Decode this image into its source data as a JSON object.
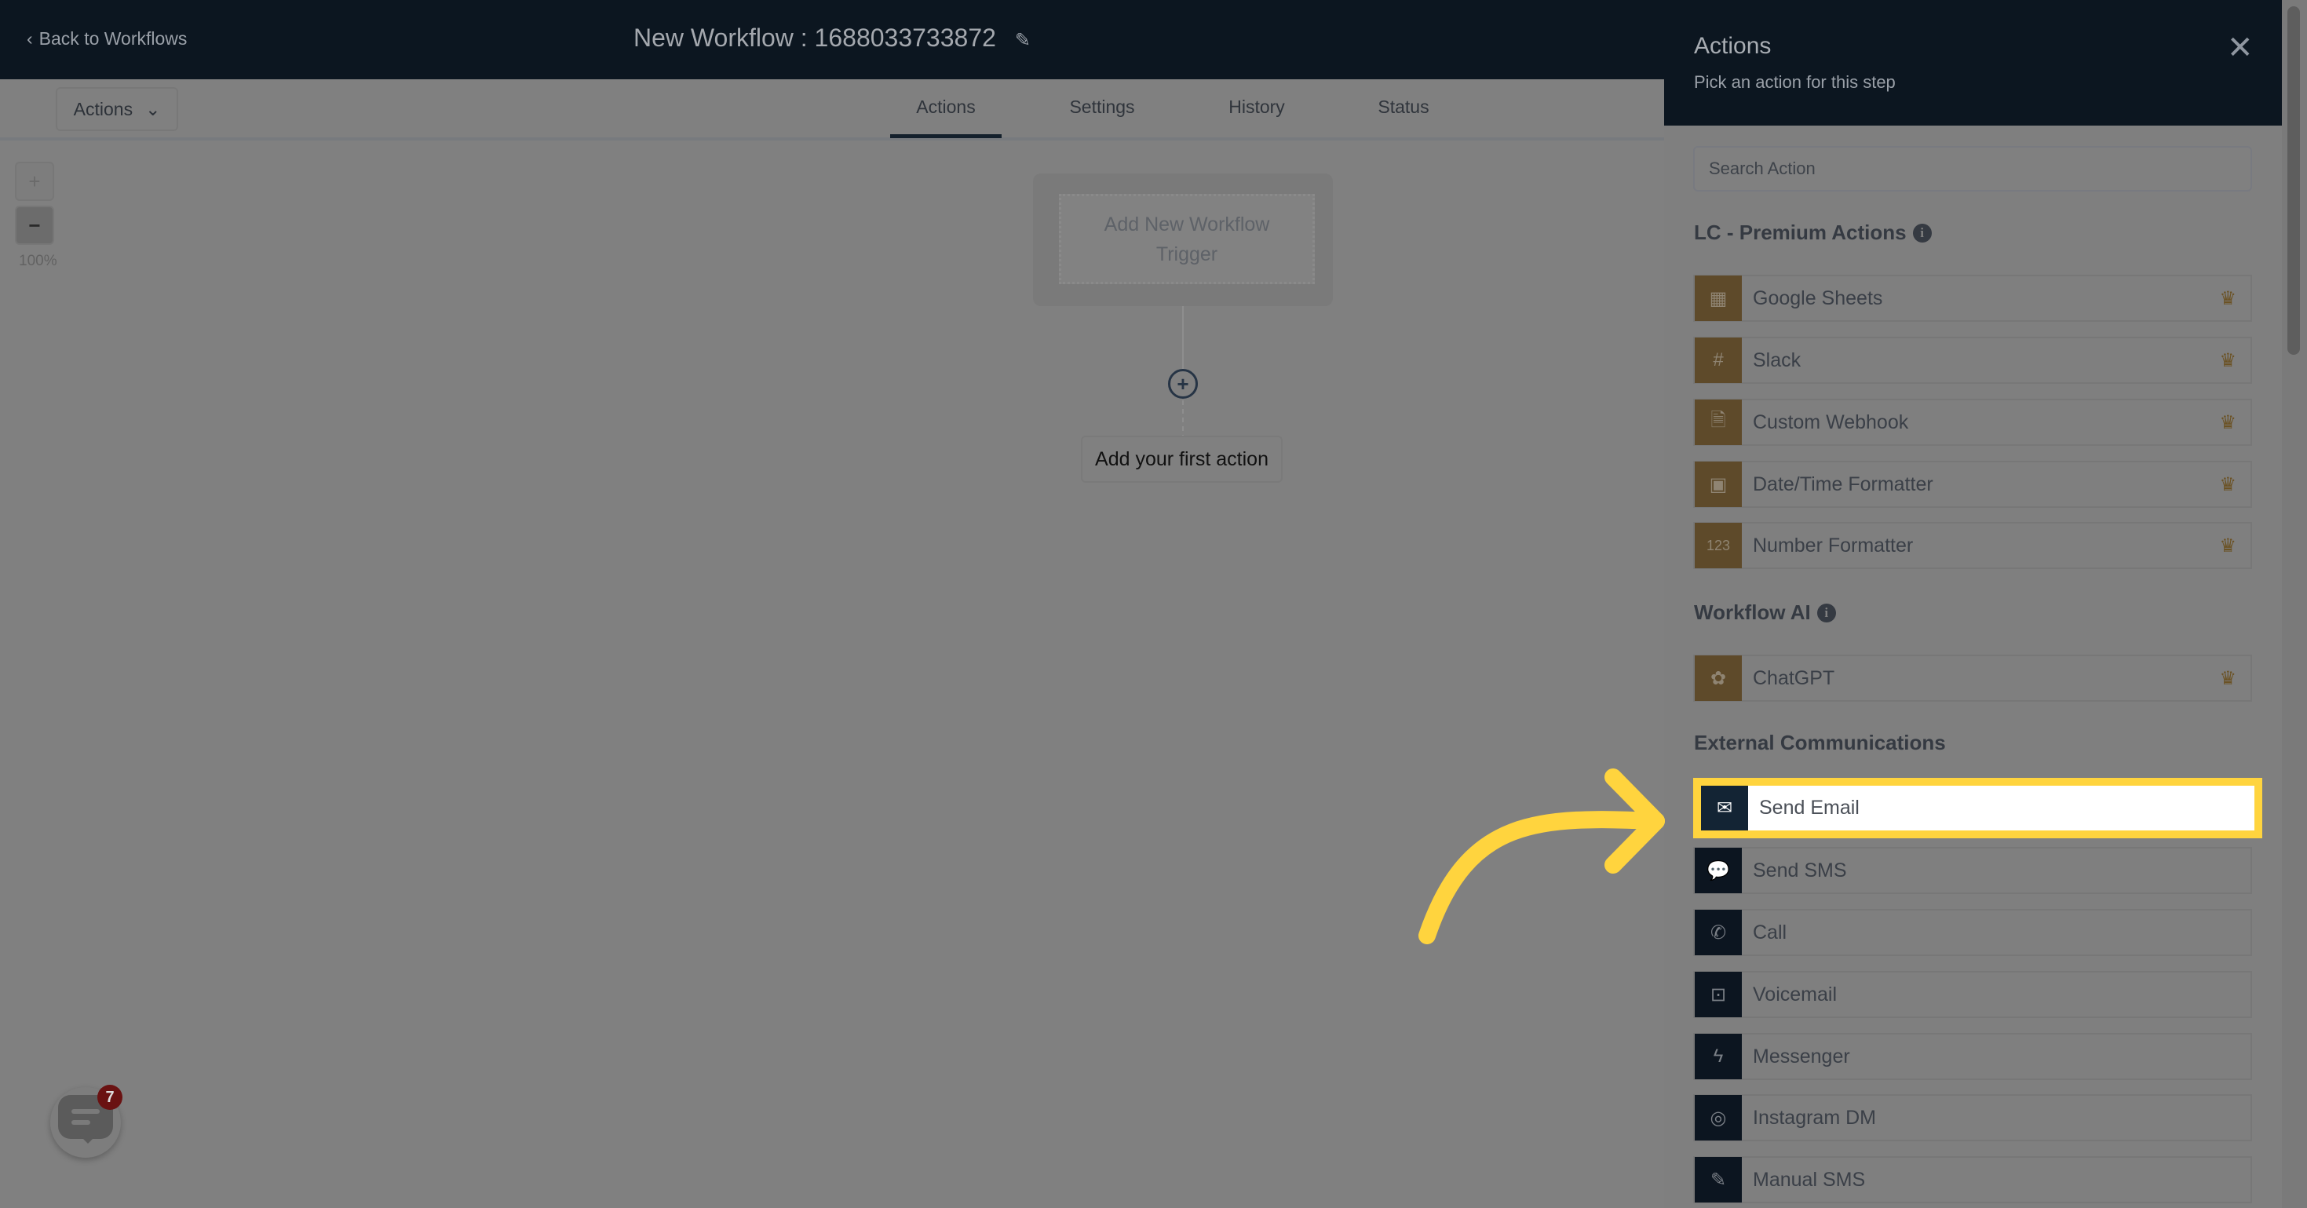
{
  "header": {
    "back_label": "Back to Workflows",
    "title": "New Workflow : 1688033733872"
  },
  "toolbar": {
    "actions_dropdown": "Actions",
    "tabs": [
      {
        "label": "Actions",
        "active": true
      },
      {
        "label": "Settings"
      },
      {
        "label": "History"
      },
      {
        "label": "Status"
      }
    ]
  },
  "canvas": {
    "zoom_in": "+",
    "zoom_out": "−",
    "zoom_level": "100%",
    "trigger_label": "Add New Workflow Trigger",
    "first_action_label": "Add your first action"
  },
  "chat_widget": {
    "badge_count": "7"
  },
  "panel": {
    "title": "Actions",
    "subtitle": "Pick an action for this step",
    "search_placeholder": "Search Action",
    "sections": [
      {
        "heading": "LC - Premium Actions",
        "items": [
          {
            "label": "Google Sheets",
            "icon": "spreadsheet-icon"
          },
          {
            "label": "Slack",
            "icon": "slack-icon"
          },
          {
            "label": "Custom Webhook",
            "icon": "webhook-icon"
          },
          {
            "label": "Date/Time Formatter",
            "icon": "calendar-icon"
          },
          {
            "label": "Number Formatter",
            "icon": "123-icon"
          }
        ]
      },
      {
        "heading": "Workflow AI",
        "items": [
          {
            "label": "ChatGPT",
            "icon": "openai-icon"
          }
        ]
      },
      {
        "heading": "External Communications",
        "items": [
          {
            "label": "Send Email",
            "icon": "email-icon",
            "highlighted": true
          },
          {
            "label": "Send SMS",
            "icon": "sms-icon"
          },
          {
            "label": "Call",
            "icon": "phone-icon"
          },
          {
            "label": "Voicemail",
            "icon": "voicemail-icon"
          },
          {
            "label": "Messenger",
            "icon": "messenger-icon"
          },
          {
            "label": "Instagram DM",
            "icon": "instagram-icon"
          },
          {
            "label": "Manual SMS",
            "icon": "manual-sms-icon"
          }
        ]
      }
    ]
  },
  "colors": {
    "highlight": "#ffd43e",
    "premium_icon_bg": "#5e4a2a",
    "comm_icon_bg": "#0c1520",
    "header_bg": "#0c1620"
  }
}
